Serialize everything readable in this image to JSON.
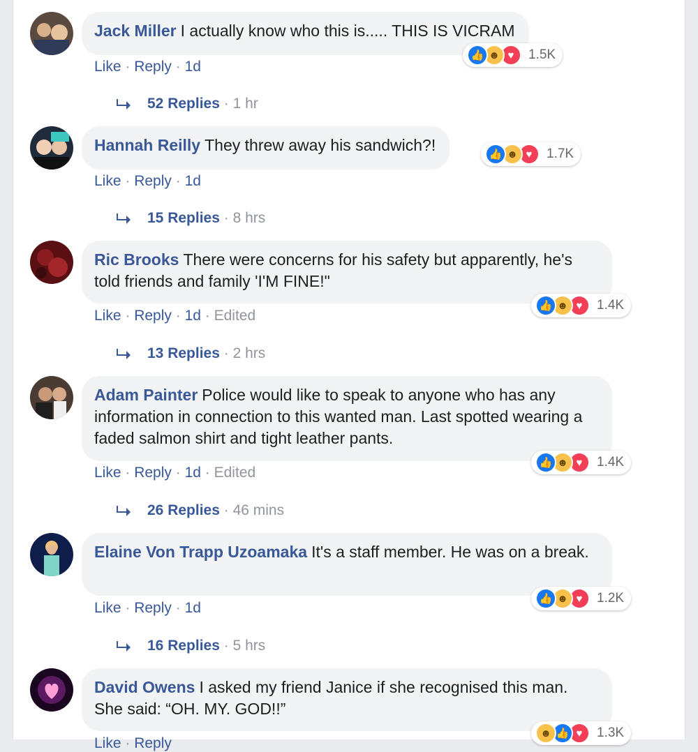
{
  "comments": [
    {
      "author": "Jack Miller",
      "text": "I actually know who this is..... THIS IS VICRAM",
      "reaction_count": "1.5K",
      "reaction_order": [
        "like",
        "haha",
        "love"
      ],
      "like": "Like",
      "reply": "Reply",
      "time": "1d",
      "edited": "",
      "replies_label": "52 Replies",
      "replies_age": "1 hr"
    },
    {
      "author": "Hannah Reilly",
      "text": "They threw away his sandwich?!",
      "reaction_count": "1.7K",
      "reaction_order": [
        "like",
        "haha",
        "love"
      ],
      "like": "Like",
      "reply": "Reply",
      "time": "1d",
      "edited": "",
      "replies_label": "15 Replies",
      "replies_age": "8 hrs"
    },
    {
      "author": "Ric Brooks",
      "text": "There were concerns for his safety but apparently, he's told friends and family 'I'M FINE!\"",
      "reaction_count": "1.4K",
      "reaction_order": [
        "like",
        "haha",
        "love"
      ],
      "like": "Like",
      "reply": "Reply",
      "time": "1d",
      "edited": "Edited",
      "replies_label": "13 Replies",
      "replies_age": "2 hrs"
    },
    {
      "author": "Adam Painter",
      "text": "Police would like to speak to anyone who has any information in connection to this wanted man. Last spotted wearing a faded salmon shirt and tight leather pants.",
      "reaction_count": "1.4K",
      "reaction_order": [
        "like",
        "haha",
        "love"
      ],
      "like": "Like",
      "reply": "Reply",
      "time": "1d",
      "edited": "Edited",
      "replies_label": "26 Replies",
      "replies_age": "46 mins"
    },
    {
      "author": "Elaine Von Trapp Uzoamaka",
      "text": "It's a staff member. He was on a break.",
      "reaction_count": "1.2K",
      "reaction_order": [
        "like",
        "haha",
        "love"
      ],
      "like": "Like",
      "reply": "Reply",
      "time": "1d",
      "edited": "",
      "replies_label": "16 Replies",
      "replies_age": "5 hrs"
    },
    {
      "author": "David Owens",
      "text": "I asked my friend Janice if she recognised this man. She said: “OH. MY. GOD!!”",
      "reaction_count": "1.3K",
      "reaction_order": [
        "haha",
        "like",
        "love"
      ],
      "like": "Like",
      "reply": "Reply",
      "time": "",
      "edited": "",
      "replies_label": "",
      "replies_age": ""
    }
  ],
  "icons": {
    "like": "like-icon",
    "haha": "haha-icon",
    "love": "love-icon",
    "reply_arrow": "reply-arrow-icon"
  },
  "colors": {
    "author": "#385898",
    "bubble": "#f2f3f5",
    "meta": "#90949c",
    "like": "#1877f2",
    "haha": "#f7c14b",
    "love": "#f33e58",
    "page": "#e9ebee"
  }
}
